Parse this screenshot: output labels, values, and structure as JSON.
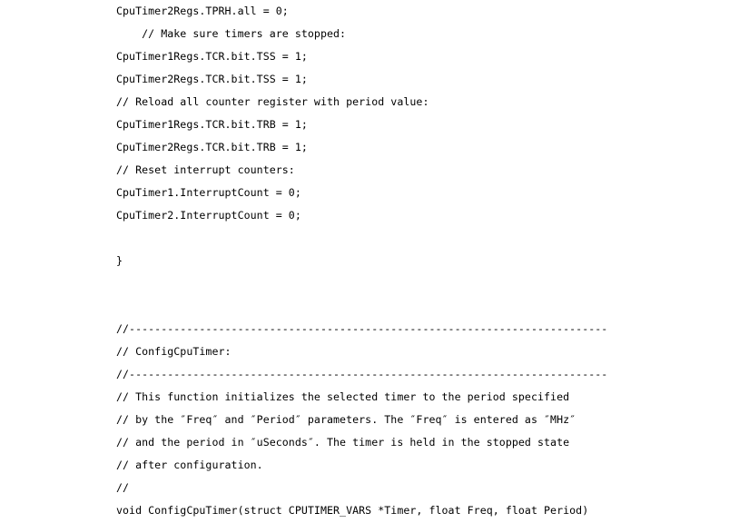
{
  "document": {
    "kind": "source-code-listing",
    "language": "c",
    "background_color": "#ffffff",
    "text_color": "#000000",
    "lines": [
      {
        "id": "line-1",
        "text": "CpuTimer2Regs.TPRH.all = 0;"
      },
      {
        "id": "line-2",
        "text": "    // Make sure timers are stopped:"
      },
      {
        "id": "line-3",
        "text": "CpuTimer1Regs.TCR.bit.TSS = 1;"
      },
      {
        "id": "line-4",
        "text": "CpuTimer2Regs.TCR.bit.TSS = 1;"
      },
      {
        "id": "line-5",
        "text": "// Reload all counter register with period value:"
      },
      {
        "id": "line-6",
        "text": "CpuTimer1Regs.TCR.bit.TRB = 1;"
      },
      {
        "id": "line-7",
        "text": "CpuTimer2Regs.TCR.bit.TRB = 1;"
      },
      {
        "id": "line-8",
        "text": "// Reset interrupt counters:"
      },
      {
        "id": "line-9",
        "text": "CpuTimer1.InterruptCount = 0;"
      },
      {
        "id": "line-10",
        "text": "CpuTimer2.InterruptCount = 0;"
      },
      {
        "id": "line-11",
        "text": ""
      },
      {
        "id": "line-12",
        "text": "}"
      },
      {
        "id": "line-13",
        "text": ""
      },
      {
        "id": "line-14",
        "text": ""
      },
      {
        "id": "line-15",
        "text": "//---------------------------------------------------------------------------"
      },
      {
        "id": "line-16",
        "text": "// ConfigCpuTimer:"
      },
      {
        "id": "line-17",
        "text": "//---------------------------------------------------------------------------"
      },
      {
        "id": "line-18",
        "text": "// This function initializes the selected timer to the period specified"
      },
      {
        "id": "line-19",
        "text": "// by the ″Freq″ and ″Period″ parameters. The ″Freq″ is entered as ″MHz″"
      },
      {
        "id": "line-20",
        "text": "// and the period in ″uSeconds″. The timer is held in the stopped state"
      },
      {
        "id": "line-21",
        "text": "// after configuration."
      },
      {
        "id": "line-22",
        "text": "//"
      },
      {
        "id": "line-23",
        "text": "void ConfigCpuTimer(struct CPUTIMER_VARS *Timer, float Freq, float Period)"
      }
    ]
  }
}
